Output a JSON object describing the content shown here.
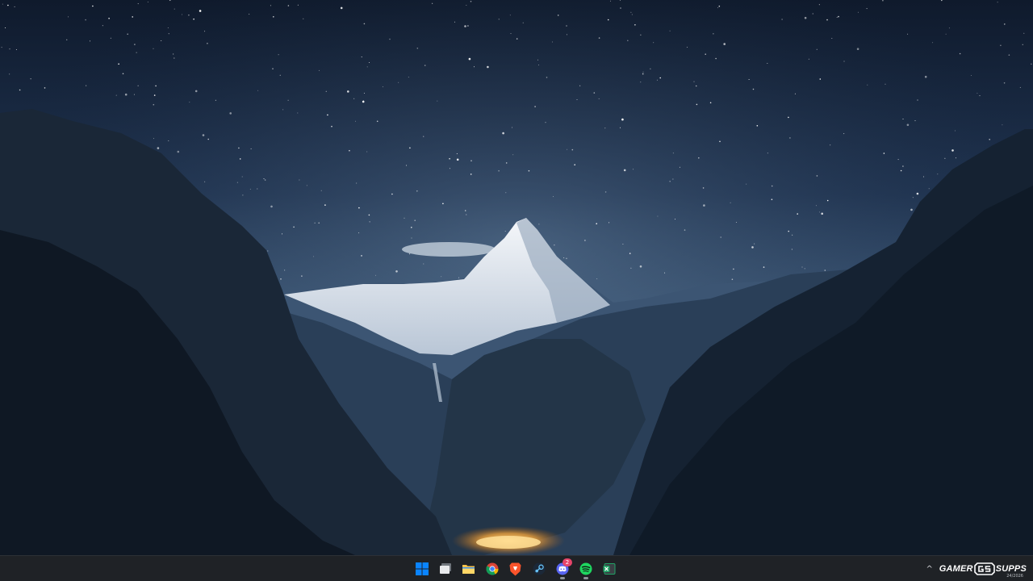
{
  "desktop": {
    "wallpaper": "night mountain valley with starry sky and snow-capped peak"
  },
  "taskbar": {
    "pinned_apps": [
      {
        "name": "Start",
        "icon": "windows-start-icon",
        "running": false
      },
      {
        "name": "Task View",
        "icon": "task-view-icon",
        "running": false
      },
      {
        "name": "File Explorer",
        "icon": "folder-icon",
        "running": false
      },
      {
        "name": "Chrome",
        "icon": "chrome-icon",
        "running": false
      },
      {
        "name": "Brave",
        "icon": "brave-lion-icon",
        "running": false
      },
      {
        "name": "Steam",
        "icon": "steam-icon",
        "running": false
      },
      {
        "name": "Discord",
        "icon": "discord-icon",
        "running": true,
        "badge": "2"
      },
      {
        "name": "Spotify",
        "icon": "spotify-icon",
        "running": true
      },
      {
        "name": "Excel",
        "icon": "excel-icon",
        "running": false
      }
    ],
    "tray": {
      "chevron": "^",
      "brand_left": "GAMER",
      "brand_right": "SUPPS",
      "brand_date": "24/2026"
    }
  },
  "colors": {
    "taskbar_bg": "#1f2226",
    "accent_blue": "#0a84ff",
    "spotify_green": "#1ed760",
    "discord_purple": "#5865f2",
    "brave_orange": "#fb542b",
    "folder_yellow": "#f8c14a",
    "excel_green": "#21a366"
  }
}
